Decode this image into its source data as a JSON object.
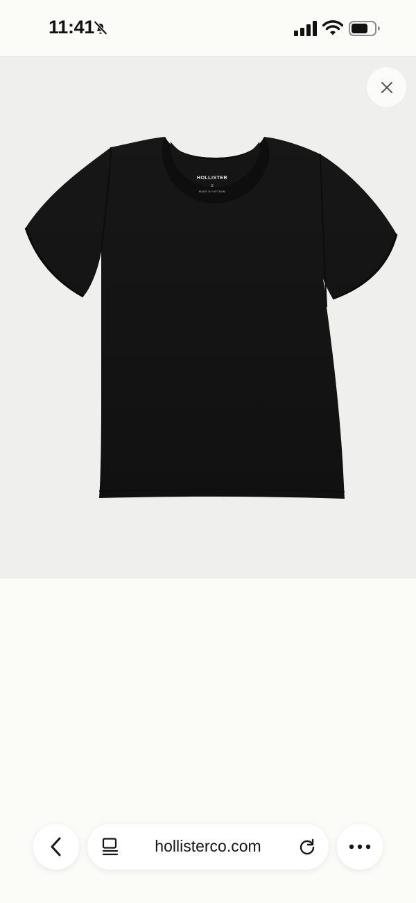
{
  "status_bar": {
    "time": "11:41",
    "icons": [
      "bell-slash-icon",
      "cellular-signal-icon",
      "wifi-icon",
      "battery-icon"
    ]
  },
  "product": {
    "brand_label": "HOLLISTER",
    "size_label": "S",
    "origin_label": "MADE IN VIETNAM",
    "color": "#141414",
    "background": "#efefee",
    "close_icon": "close-icon"
  },
  "browser": {
    "url": "hollisterco.com",
    "back_icon": "chevron-left-icon",
    "tabs_icon": "tabs-icon",
    "reload_icon": "reload-icon",
    "more_icon": "more-icon"
  }
}
